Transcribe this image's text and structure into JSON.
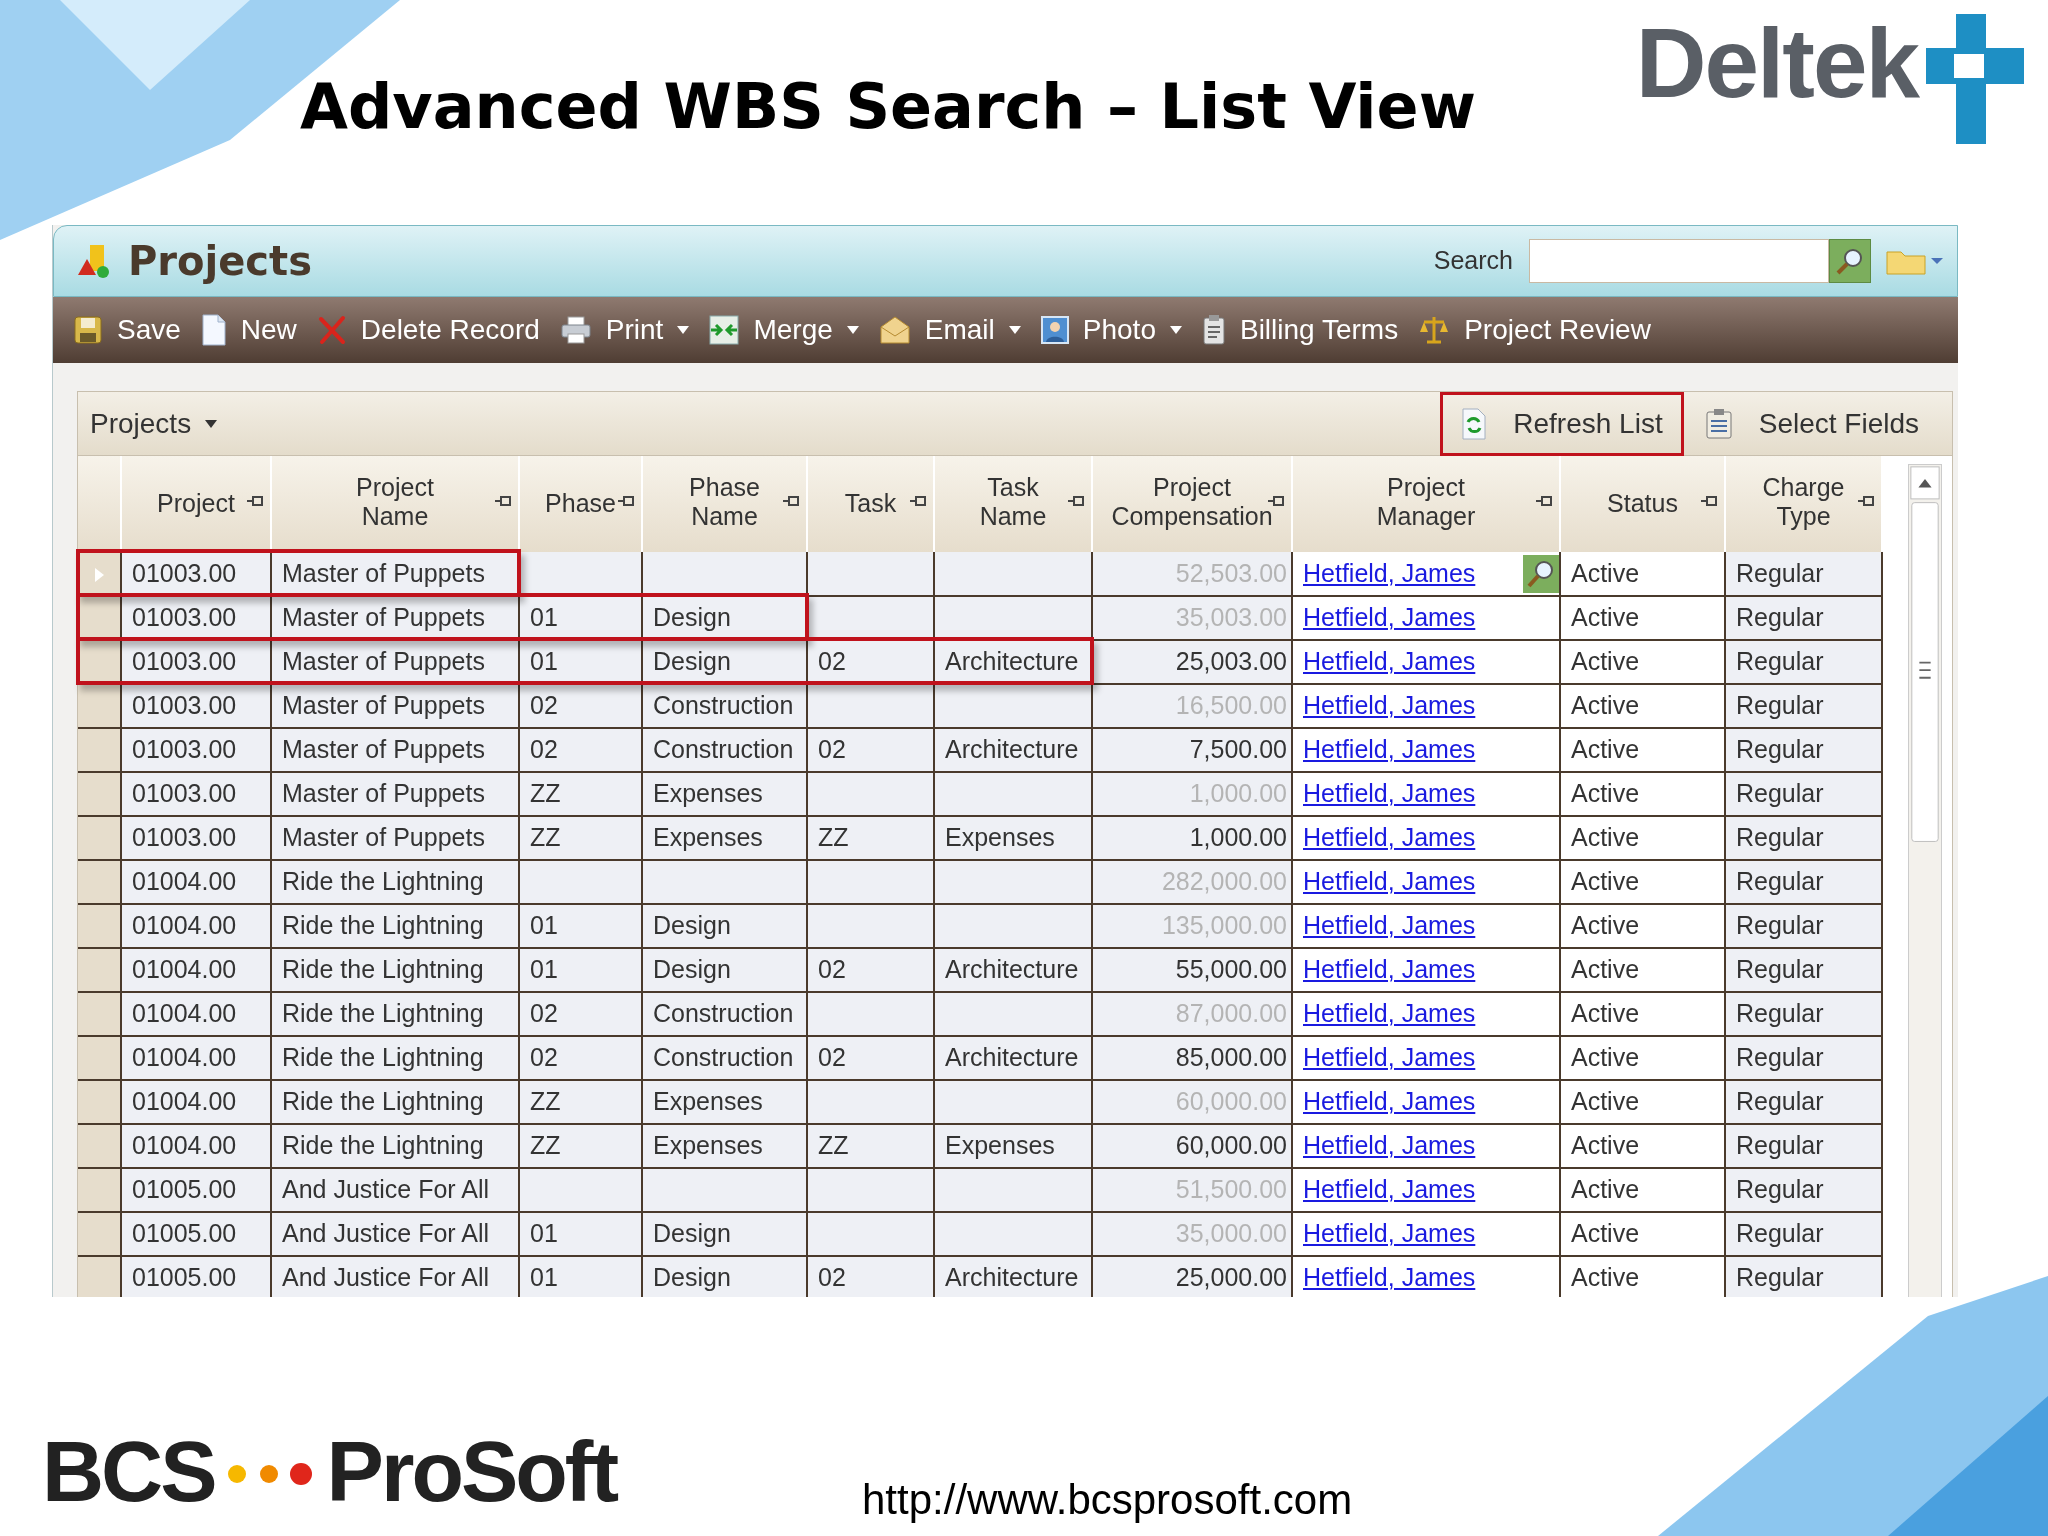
{
  "slide": {
    "title": "Advanced WBS Search – List View",
    "url": "http://www.bcsprosoft.com"
  },
  "logos": {
    "deltek": "Deltek",
    "bcs_left": "BCS",
    "bcs_right": "ProSoft"
  },
  "app": {
    "title": "Projects",
    "search": {
      "label": "Search"
    },
    "toolbar": [
      {
        "label": "Save",
        "dropdown": false
      },
      {
        "label": "New",
        "dropdown": false
      },
      {
        "label": "Delete Record",
        "dropdown": false
      },
      {
        "label": "Print",
        "dropdown": true
      },
      {
        "label": "Merge",
        "dropdown": true
      },
      {
        "label": "Email",
        "dropdown": true
      },
      {
        "label": "Photo",
        "dropdown": true
      },
      {
        "label": "Billing Terms",
        "dropdown": false
      },
      {
        "label": "Project Review",
        "dropdown": false
      }
    ],
    "grid": {
      "view_label": "Projects",
      "actions": [
        {
          "label": "Refresh List",
          "highlighted": true
        },
        {
          "label": "Select Fields",
          "highlighted": false
        }
      ],
      "columns": [
        "Project",
        "Project\nName",
        "Phase",
        "Phase\nName",
        "Task",
        "Task\nName",
        "Project\nCompensation",
        "Project\nManager",
        "Status",
        "Charge\nType"
      ],
      "rows": [
        {
          "selected": true,
          "highlighted": true,
          "computed": true,
          "project": "01003.00",
          "project_name": "Master of Puppets",
          "compensation": "52,503.00",
          "manager": "Hetfield, James",
          "status": "Active",
          "charge_type": "Regular"
        },
        {
          "selected": false,
          "highlighted": true,
          "computed": true,
          "project": "01003.00",
          "project_name": "Master of Puppets",
          "phase": "01",
          "phase_name": "Design",
          "compensation": "35,003.00",
          "manager": "Hetfield, James",
          "status": "Active",
          "charge_type": "Regular"
        },
        {
          "selected": false,
          "highlighted": true,
          "computed": false,
          "project": "01003.00",
          "project_name": "Master of Puppets",
          "phase": "01",
          "phase_name": "Design",
          "task": "02",
          "task_name": "Architecture",
          "compensation": "25,003.00",
          "manager": "Hetfield, James",
          "status": "Active",
          "charge_type": "Regular"
        },
        {
          "selected": false,
          "highlighted": false,
          "computed": true,
          "project": "01003.00",
          "project_name": "Master of Puppets",
          "phase": "02",
          "phase_name": "Construction",
          "compensation": "16,500.00",
          "manager": "Hetfield, James",
          "status": "Active",
          "charge_type": "Regular"
        },
        {
          "selected": false,
          "highlighted": false,
          "computed": false,
          "project": "01003.00",
          "project_name": "Master of Puppets",
          "phase": "02",
          "phase_name": "Construction",
          "task": "02",
          "task_name": "Architecture",
          "compensation": "7,500.00",
          "manager": "Hetfield, James",
          "status": "Active",
          "charge_type": "Regular"
        },
        {
          "selected": false,
          "highlighted": false,
          "computed": true,
          "project": "01003.00",
          "project_name": "Master of Puppets",
          "phase": "ZZ",
          "phase_name": "Expenses",
          "compensation": "1,000.00",
          "manager": "Hetfield, James",
          "status": "Active",
          "charge_type": "Regular"
        },
        {
          "selected": false,
          "highlighted": false,
          "computed": false,
          "project": "01003.00",
          "project_name": "Master of Puppets",
          "phase": "ZZ",
          "phase_name": "Expenses",
          "task": "ZZ",
          "task_name": "Expenses",
          "compensation": "1,000.00",
          "manager": "Hetfield, James",
          "status": "Active",
          "charge_type": "Regular"
        },
        {
          "selected": false,
          "highlighted": false,
          "computed": true,
          "project": "01004.00",
          "project_name": "Ride the Lightning",
          "compensation": "282,000.00",
          "manager": "Hetfield, James",
          "status": "Active",
          "charge_type": "Regular"
        },
        {
          "selected": false,
          "highlighted": false,
          "computed": true,
          "project": "01004.00",
          "project_name": "Ride the Lightning",
          "phase": "01",
          "phase_name": "Design",
          "compensation": "135,000.00",
          "manager": "Hetfield, James",
          "status": "Active",
          "charge_type": "Regular"
        },
        {
          "selected": false,
          "highlighted": false,
          "computed": false,
          "project": "01004.00",
          "project_name": "Ride the Lightning",
          "phase": "01",
          "phase_name": "Design",
          "task": "02",
          "task_name": "Architecture",
          "compensation": "55,000.00",
          "manager": "Hetfield, James",
          "status": "Active",
          "charge_type": "Regular"
        },
        {
          "selected": false,
          "highlighted": false,
          "computed": true,
          "project": "01004.00",
          "project_name": "Ride the Lightning",
          "phase": "02",
          "phase_name": "Construction",
          "compensation": "87,000.00",
          "manager": "Hetfield, James",
          "status": "Active",
          "charge_type": "Regular"
        },
        {
          "selected": false,
          "highlighted": false,
          "computed": false,
          "project": "01004.00",
          "project_name": "Ride the Lightning",
          "phase": "02",
          "phase_name": "Construction",
          "task": "02",
          "task_name": "Architecture",
          "compensation": "85,000.00",
          "manager": "Hetfield, James",
          "status": "Active",
          "charge_type": "Regular"
        },
        {
          "selected": false,
          "highlighted": false,
          "computed": true,
          "project": "01004.00",
          "project_name": "Ride the Lightning",
          "phase": "ZZ",
          "phase_name": "Expenses",
          "compensation": "60,000.00",
          "manager": "Hetfield, James",
          "status": "Active",
          "charge_type": "Regular"
        },
        {
          "selected": false,
          "highlighted": false,
          "computed": false,
          "project": "01004.00",
          "project_name": "Ride the Lightning",
          "phase": "ZZ",
          "phase_name": "Expenses",
          "task": "ZZ",
          "task_name": "Expenses",
          "compensation": "60,000.00",
          "manager": "Hetfield, James",
          "status": "Active",
          "charge_type": "Regular"
        },
        {
          "selected": false,
          "highlighted": false,
          "computed": true,
          "project": "01005.00",
          "project_name": "And Justice For All",
          "compensation": "51,500.00",
          "manager": "Hetfield, James",
          "status": "Active",
          "charge_type": "Regular"
        },
        {
          "selected": false,
          "highlighted": false,
          "computed": true,
          "project": "01005.00",
          "project_name": "And Justice For All",
          "phase": "01",
          "phase_name": "Design",
          "compensation": "35,000.00",
          "manager": "Hetfield, James",
          "status": "Active",
          "charge_type": "Regular"
        },
        {
          "selected": false,
          "highlighted": false,
          "computed": false,
          "project": "01005.00",
          "project_name": "And Justice For All",
          "phase": "01",
          "phase_name": "Design",
          "task": "02",
          "task_name": "Architecture",
          "compensation": "25,000.00",
          "manager": "Hetfield, James",
          "status": "Active",
          "charge_type": "Regular"
        }
      ]
    }
  }
}
